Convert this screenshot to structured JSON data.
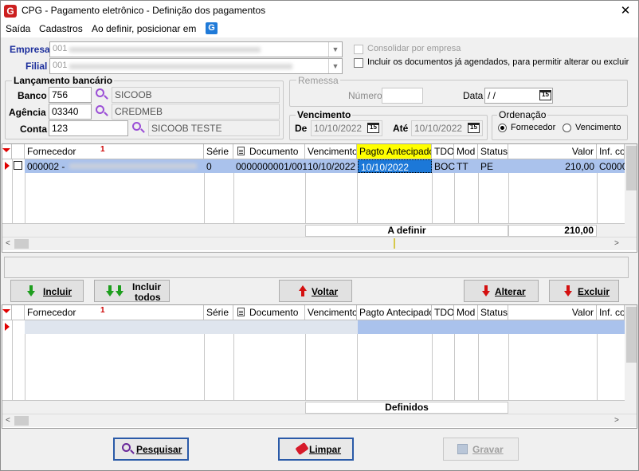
{
  "window": {
    "title": "CPG - Pagamento eletrônico - Definição dos pagamentos",
    "close": "✕",
    "app_icon": "G"
  },
  "menu": {
    "items": [
      "Saída",
      "Cadastros",
      "Ao definir, posicionar em"
    ],
    "g_icon": "G"
  },
  "empresa": {
    "label": "Empresa",
    "code": "001"
  },
  "filial": {
    "label": "Filial",
    "code": "001"
  },
  "options": {
    "consolidar": {
      "label": "Consolidar por empresa",
      "checked": false,
      "enabled": false
    },
    "incluir_agendados": {
      "label": "Incluir os documentos já agendados, para permitir alterar ou excluir",
      "checked": false
    }
  },
  "lancamento": {
    "title": "Lançamento bancário",
    "banco": {
      "label": "Banco",
      "code": "756",
      "name": "SICOOB"
    },
    "agencia": {
      "label": "Agência",
      "code": "03340",
      "name": "CREDMEB"
    },
    "conta": {
      "label": "Conta",
      "code": "123",
      "name": "SICOOB TESTE"
    }
  },
  "remessa": {
    "title": "Remessa",
    "numero_label": "Número",
    "numero": "",
    "data_label": "Data",
    "data": " /  /"
  },
  "vencimento": {
    "title": "Vencimento",
    "de_label": "De",
    "de": "10/10/2022",
    "ate_label": "Até",
    "ate": "10/10/2022"
  },
  "ordenacao": {
    "title": "Ordenação",
    "options": [
      "Fornecedor",
      "Vencimento"
    ],
    "selected": "Fornecedor"
  },
  "columns": [
    "Fornecedor",
    "Série",
    "Documento",
    "Vencimento",
    "Pagto Antecipado",
    "TDO",
    "Mod",
    "Status",
    "Valor",
    "Inf. com"
  ],
  "sort_indicator": "1",
  "calendar_icon": "15",
  "top_grid": {
    "rows": [
      {
        "fornecedor": "000002 -",
        "serie": "0",
        "documento": "0000000001/001",
        "vencimento": "10/10/2022",
        "pagto_antecipado": "10/10/2022",
        "tdo": "BOC",
        "mod": "TT",
        "status": "PE",
        "valor": "210,00",
        "inf": "C0000"
      }
    ],
    "footer_label": "A definir",
    "footer_total": "210,00"
  },
  "bottom_grid": {
    "rows": [],
    "footer_label": "Definidos"
  },
  "buttons": {
    "incluir": "Incluir",
    "incluir_todos": [
      "Incluir",
      "todos"
    ],
    "voltar": "Voltar",
    "alterar": "Alterar",
    "excluir": "Excluir",
    "pesquisar": "Pesquisar",
    "limpar": "Limpar",
    "gravar": "Gravar"
  },
  "scroll": {
    "left": "<",
    "right": ">"
  },
  "colors": {
    "highlight_header": "#ffff00",
    "selected_cell": "#1c78d8",
    "selected_row": "#aac2ec",
    "label_blue": "#1c2e9c"
  }
}
